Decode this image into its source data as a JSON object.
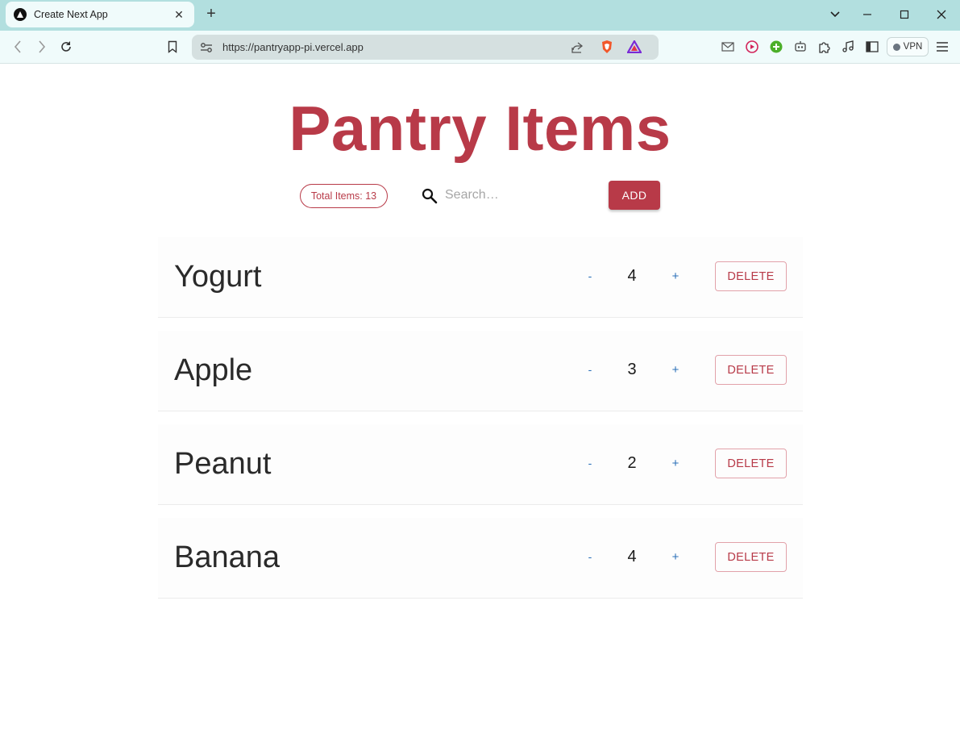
{
  "browser": {
    "tab_title": "Create Next App",
    "tab_close": "✕",
    "new_tab": "+",
    "url": "https://pantryapp-pi.vercel.app",
    "vpn_label": "VPN"
  },
  "page": {
    "title": "Pantry Items",
    "total_items_label": "Total Items: 13",
    "search_placeholder": "Search…",
    "add_label": "ADD",
    "items": [
      {
        "name": "Yogurt",
        "quantity": "4",
        "minus": "-",
        "plus": "+",
        "delete": "DELETE"
      },
      {
        "name": "Apple",
        "quantity": "3",
        "minus": "-",
        "plus": "+",
        "delete": "DELETE"
      },
      {
        "name": "Peanut",
        "quantity": "2",
        "minus": "-",
        "plus": "+",
        "delete": "DELETE"
      },
      {
        "name": "Banana",
        "quantity": "4",
        "minus": "-",
        "plus": "+",
        "delete": "DELETE"
      }
    ]
  },
  "colors": {
    "accent": "#b83a48",
    "titlebar": "#b2dfdf",
    "link_blue": "#2a6fb8"
  }
}
